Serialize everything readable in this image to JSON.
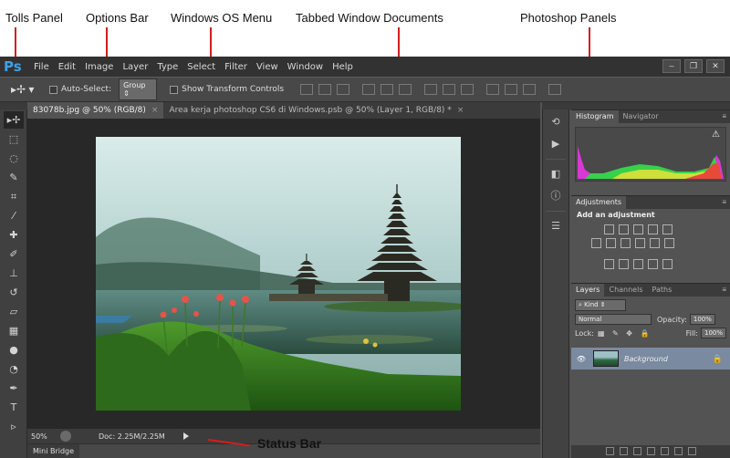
{
  "annotations": [
    {
      "key": "tools_panel",
      "label": "Tolls Panel"
    },
    {
      "key": "options_bar",
      "label": "Options Bar"
    },
    {
      "key": "windows_os_menu",
      "label": "Windows OS Menu"
    },
    {
      "key": "tabbed_window",
      "label": "Tabbed Window Documents"
    },
    {
      "key": "photoshop_panels",
      "label": "Photoshop Panels"
    },
    {
      "key": "status_bar",
      "label": "Status Bar"
    }
  ],
  "app": {
    "logo": "Ps",
    "menu": [
      "File",
      "Edit",
      "Image",
      "Layer",
      "Type",
      "Select",
      "Filter",
      "View",
      "Window",
      "Help"
    ],
    "window_buttons": [
      "–",
      "❐",
      "✕"
    ]
  },
  "options_bar": {
    "tool_icon": "move-tool-icon",
    "auto_select_label": "Auto-Select:",
    "auto_select_checked": false,
    "group_value": "Group",
    "show_transform_label": "Show Transform Controls",
    "show_transform_checked": false
  },
  "tabs": [
    {
      "label": "83078b.jpg @ 50% (RGB/8)",
      "active": true
    },
    {
      "label": "Area kerja photoshop CS6 di Windows.psb @ 50% (Layer 1, RGB/8) *",
      "active": false
    }
  ],
  "tools": [
    {
      "icon": "move-tool-icon",
      "glyph": "▸✢"
    },
    {
      "icon": "marquee-tool-icon",
      "glyph": "⬚"
    },
    {
      "icon": "lasso-tool-icon",
      "glyph": "◌"
    },
    {
      "icon": "quick-select-tool-icon",
      "glyph": "✎"
    },
    {
      "icon": "crop-tool-icon",
      "glyph": "⌗"
    },
    {
      "icon": "eyedropper-tool-icon",
      "glyph": "⁄"
    },
    {
      "icon": "healing-tool-icon",
      "glyph": "✚"
    },
    {
      "icon": "brush-tool-icon",
      "glyph": "✐"
    },
    {
      "icon": "stamp-tool-icon",
      "glyph": "⊥"
    },
    {
      "icon": "history-brush-icon",
      "glyph": "↺"
    },
    {
      "icon": "eraser-tool-icon",
      "glyph": "▱"
    },
    {
      "icon": "gradient-tool-icon",
      "glyph": "▦"
    },
    {
      "icon": "blur-tool-icon",
      "glyph": "●"
    },
    {
      "icon": "dodge-tool-icon",
      "glyph": "◔"
    },
    {
      "icon": "pen-tool-icon",
      "glyph": "✒"
    },
    {
      "icon": "type-tool-icon",
      "glyph": "T"
    },
    {
      "icon": "path-select-tool-icon",
      "glyph": "▹"
    }
  ],
  "status_bar": {
    "zoom": "50%",
    "doc": "Doc: 2.25M/2.25M"
  },
  "mini_bridge": {
    "label": "Mini Bridge"
  },
  "panels": {
    "histogram": {
      "tabs": [
        "Histogram",
        "Navigator"
      ],
      "warning_icon": "warning-icon"
    },
    "adjustments": {
      "tab": "Adjustments",
      "title": "Add an adjustment"
    },
    "layers": {
      "tabs": [
        "Layers",
        "Channels",
        "Paths"
      ],
      "kind_label": "Kind",
      "blend_mode": "Normal",
      "opacity_label": "Opacity:",
      "opacity_value": "100%",
      "lock_label": "Lock:",
      "fill_label": "Fill:",
      "fill_value": "100%",
      "layer_name": "Background"
    }
  },
  "colors": {
    "accent": "#3fa0e6",
    "annotation_line": "#d61d1d",
    "ui_dark": "#323232",
    "ui_mid": "#535353"
  }
}
